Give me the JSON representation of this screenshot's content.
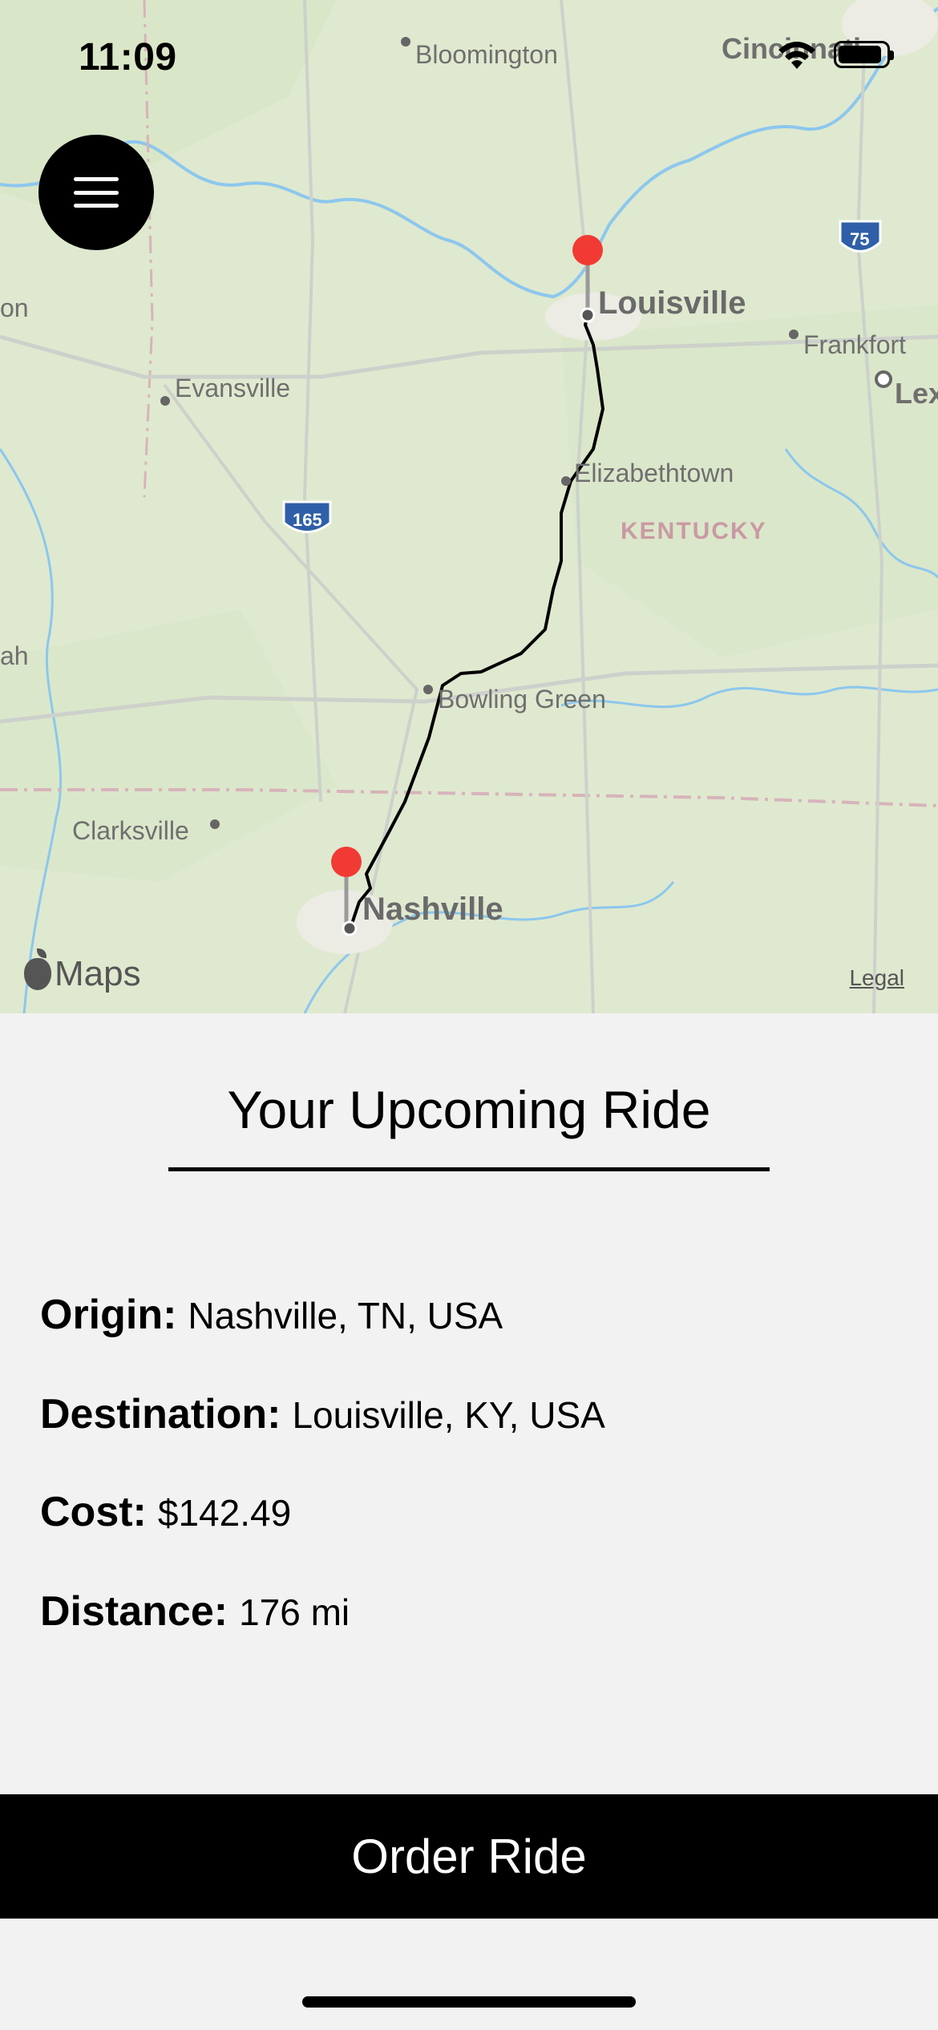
{
  "status_bar": {
    "time": "11:09"
  },
  "map": {
    "places": {
      "bloomington": "Bloomington",
      "cincinnati": "Cincinnati",
      "louisville": "Louisville",
      "frankfort": "Frankfort",
      "lex": "Lex",
      "evansville": "Evansville",
      "elizabethtown": "Elizabethtown",
      "kentucky": "KENTUCKY",
      "bowling_green": "Bowling Green",
      "clarksville": "Clarksville",
      "nashville": "Nashville",
      "left_edge_1": "on",
      "left_edge_2": "ah"
    },
    "shields": {
      "i165": "165",
      "i75": "75"
    },
    "branding": "Maps",
    "legal": "Legal",
    "colors": {
      "land": "#dfe9cf",
      "water": "#8cc7ee",
      "route": "#000000",
      "pin": "#f23a34"
    }
  },
  "ride": {
    "title": "Your Upcoming Ride",
    "origin_label": "Origin:",
    "origin_value": "Nashville, TN, USA",
    "destination_label": "Destination:",
    "destination_value": "Louisville, KY, USA",
    "cost_label": "Cost:",
    "cost_value": "$142.49",
    "distance_label": "Distance:",
    "distance_value": "176 mi"
  },
  "actions": {
    "order_label": "Order Ride"
  }
}
